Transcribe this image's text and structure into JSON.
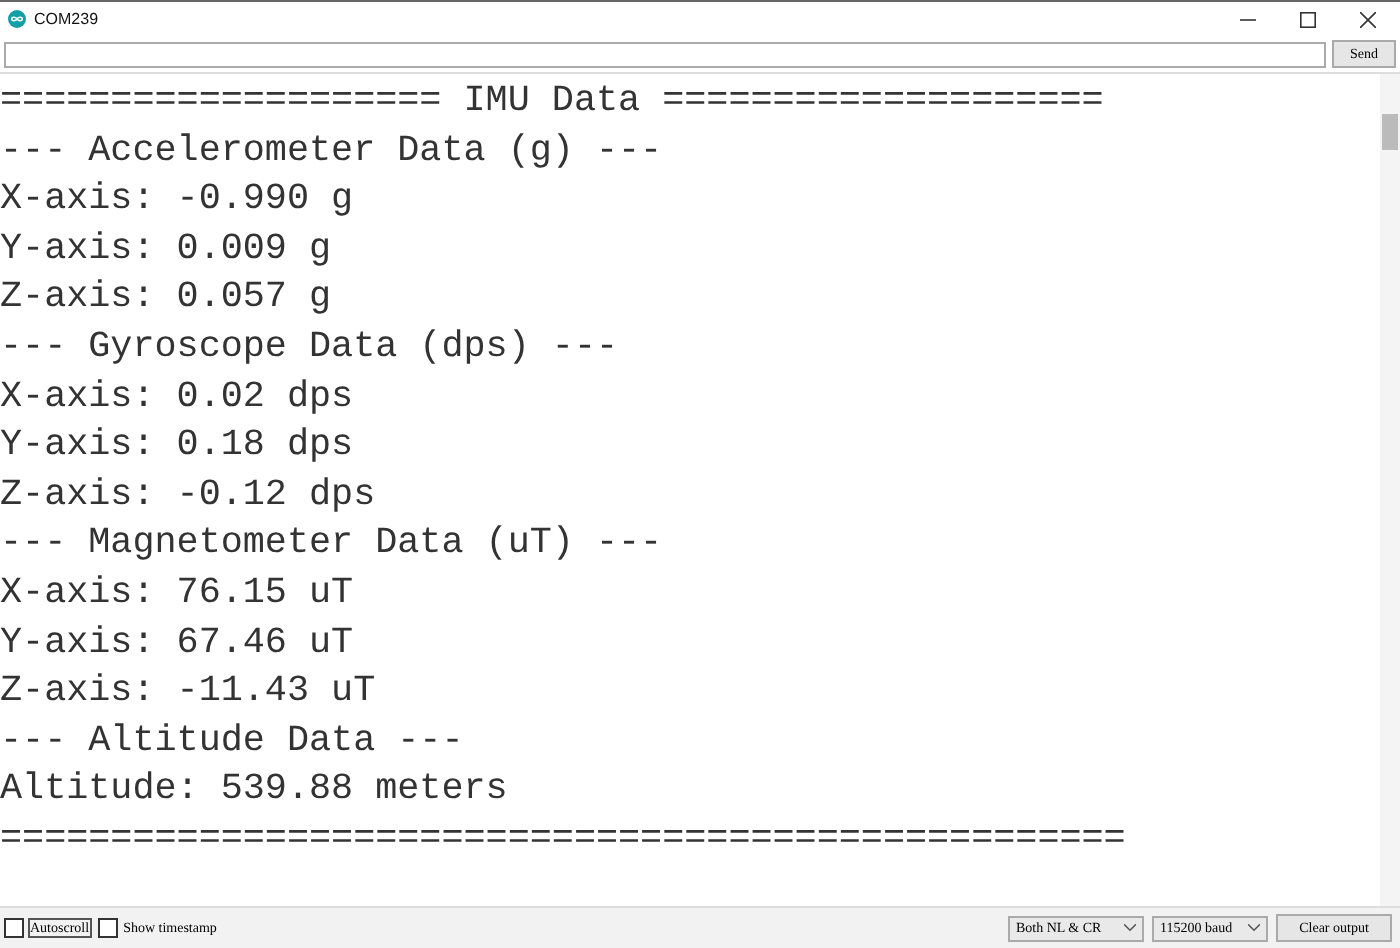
{
  "window": {
    "title": "COM239"
  },
  "send": {
    "button": "Send"
  },
  "output": {
    "lines": [
      "==================== IMU Data ====================",
      "--- Accelerometer Data (g) ---",
      "X-axis: -0.990 g",
      "Y-axis: 0.009 g",
      "Z-axis: 0.057 g",
      "--- Gyroscope Data (dps) ---",
      "X-axis: 0.02 dps",
      "Y-axis: 0.18 dps",
      "Z-axis: -0.12 dps",
      "--- Magnetometer Data (uT) ---",
      "X-axis: 76.15 uT",
      "Y-axis: 67.46 uT",
      "Z-axis: -11.43 uT",
      "--- Altitude Data ---",
      "Altitude: 539.88 meters",
      "==================================================="
    ]
  },
  "footer": {
    "checkboxes": [
      {
        "label": "Autoscroll",
        "checked": false
      },
      {
        "label": "Show timestamp",
        "checked": false
      }
    ],
    "line_ending": "Both NL & CR",
    "baud": "115200 baud",
    "clear": "Clear output"
  }
}
